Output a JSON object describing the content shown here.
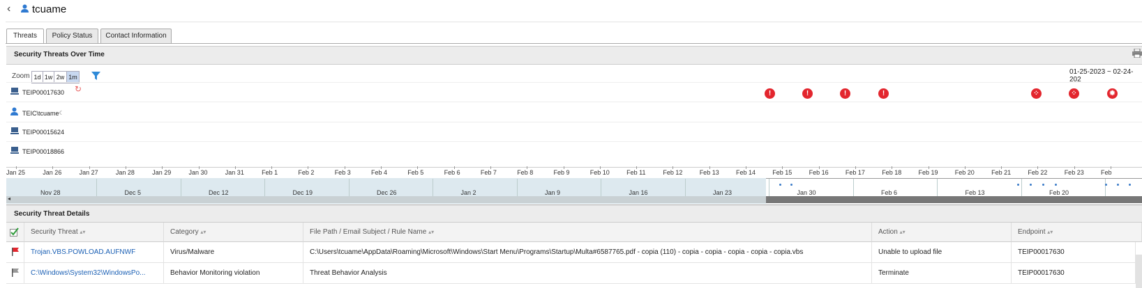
{
  "header": {
    "back_icon": "chevron-left-icon",
    "user_icon": "user-icon",
    "title": "tcuame"
  },
  "tabs": [
    {
      "label": "Threats",
      "active": true
    },
    {
      "label": "Policy Status",
      "active": false
    },
    {
      "label": "Contact Information",
      "active": false
    }
  ],
  "timeline": {
    "title": "Security Threats Over Time",
    "zoom_label": "Zoom",
    "zoom_options": [
      "1d",
      "1w",
      "2w",
      "1m"
    ],
    "zoom_selected": "1m",
    "date_range": "01-25-2023 ~ 02-24-202",
    "rows": [
      {
        "label": "TEIP00017630",
        "icon": "computer-icon"
      },
      {
        "label": "TEIC\\tcuame",
        "icon": "user-icon"
      },
      {
        "label": "TEIP00015624",
        "icon": "computer-icon"
      },
      {
        "label": "TEIP00018866",
        "icon": "computer-icon"
      }
    ],
    "threat_markers": [
      {
        "date": "Feb 14",
        "symbol": "!"
      },
      {
        "date": "Feb 15",
        "symbol": "!"
      },
      {
        "date": "Feb 16",
        "symbol": "!"
      },
      {
        "date": "Feb 17",
        "symbol": "!"
      },
      {
        "date": "Feb 21",
        "symbol": "⁘"
      },
      {
        "date": "Feb 22",
        "symbol": "⁘"
      },
      {
        "date": "Feb 23",
        "symbol": "✹"
      }
    ],
    "axis_ticks": [
      "Jan 25",
      "Jan 26",
      "Jan 27",
      "Jan 28",
      "Jan 29",
      "Jan 30",
      "Jan 31",
      "Feb 1",
      "Feb 2",
      "Feb 3",
      "Feb 4",
      "Feb 5",
      "Feb 6",
      "Feb 7",
      "Feb 8",
      "Feb 9",
      "Feb 10",
      "Feb 11",
      "Feb 12",
      "Feb 13",
      "Feb 14",
      "Feb 15",
      "Feb 16",
      "Feb 17",
      "Feb 18",
      "Feb 19",
      "Feb 20",
      "Feb 21",
      "Feb 22",
      "Feb 23",
      "Feb"
    ],
    "navigator_ticks": [
      "Nov 28",
      "Dec 5",
      "Dec 12",
      "Dec 19",
      "Dec 26",
      "Jan 2",
      "Jan 9",
      "Jan 16",
      "Jan 23",
      "Jan 30",
      "Feb 6",
      "Feb 13",
      "Feb 20"
    ]
  },
  "details": {
    "title": "Security Threat Details",
    "columns": [
      "Security Threat",
      "Category",
      "File Path / Email Subject / Rule Name",
      "Action",
      "Endpoint"
    ],
    "rows": [
      {
        "flag": "red",
        "threat": "Trojan.VBS.POWLOAD.AUFNWF",
        "category": "Virus/Malware",
        "path": "C:\\Users\\tcuame\\AppData\\Roaming\\Microsoft\\Windows\\Start Menu\\Programs\\Startup\\Multa#6587765.pdf - copia (110) - copia - copia - copia - copia - copia.vbs",
        "action": "Unable to upload file",
        "endpoint": "TEIP00017630"
      },
      {
        "flag": "gray",
        "threat": "C:\\Windows\\System32\\WindowsPo...",
        "category": "Behavior Monitoring violation",
        "path": "Threat Behavior Analysis",
        "action": "Terminate",
        "endpoint": "TEIP00017630"
      }
    ]
  },
  "colors": {
    "threat_red": "#e3262e",
    "link_blue": "#1a5fb4",
    "navigator_bg": "#dde9ef"
  }
}
